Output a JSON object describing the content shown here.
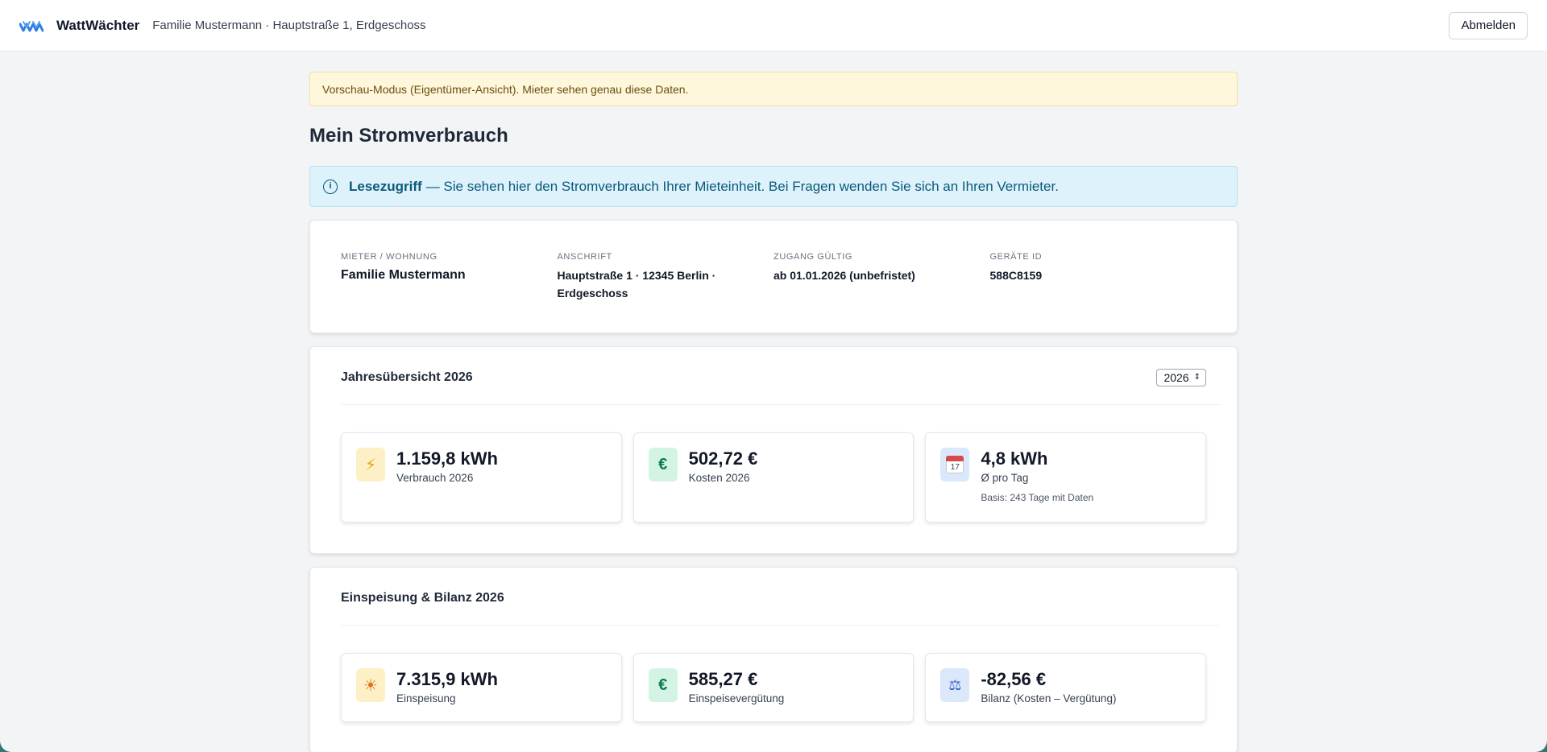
{
  "header": {
    "brand": "WattWächter",
    "subtitle": "Familie Mustermann · Hauptstraße 1, Erdgeschoss",
    "logout_label": "Abmelden"
  },
  "preview_banner": "Vorschau-Modus (Eigentümer-Ansicht). Mieter sehen genau diese Daten.",
  "page_title": "Mein Stromverbrauch",
  "info_banner": {
    "icon": "info-circle-icon",
    "strong": "Lesezugriff",
    "text": "— Sie sehen hier den Stromverbrauch Ihrer Mieteinheit. Bei Fragen wenden Sie sich an Ihren Vermieter."
  },
  "details": [
    {
      "label": "MIETER / WOHNUNG",
      "value": "Familie Mustermann"
    },
    {
      "label": "ANSCHRIFT",
      "value": "Hauptstraße 1 · 12345 Berlin · Erdgeschoss"
    },
    {
      "label": "ZUGANG GÜLTIG",
      "value": "ab 01.01.2026 (unbefristet)"
    },
    {
      "label": "GERÄTE ID",
      "value": "588C8159"
    }
  ],
  "year_overview": {
    "title": "Jahresübersicht 2026",
    "year_select": "2026",
    "stats": [
      {
        "icon": "lightning-icon",
        "value": "1.159,8 kWh",
        "label": "Verbrauch 2026"
      },
      {
        "icon": "euro-icon",
        "value": "502,72 €",
        "label": "Kosten 2026"
      },
      {
        "icon": "calendar-icon",
        "calendar_day": "17",
        "value": "4,8 kWh",
        "label": "Ø pro Tag",
        "note": "Basis: 243 Tage mit Daten"
      }
    ]
  },
  "feed_in": {
    "title": "Einspeisung & Bilanz 2026",
    "stats": [
      {
        "icon": "sun-icon",
        "value": "7.315,9 kWh",
        "label": "Einspeisung"
      },
      {
        "icon": "euro-icon",
        "value": "585,27 €",
        "label": "Einspeisevergütung"
      },
      {
        "icon": "scales-icon",
        "value": "-82,56 €",
        "label": "Bilanz (Kosten – Vergütung)"
      }
    ]
  },
  "colors": {
    "accent": "#2f7de1",
    "info_bg": "#ddf2fb",
    "preview_bg": "#fef7dc"
  }
}
